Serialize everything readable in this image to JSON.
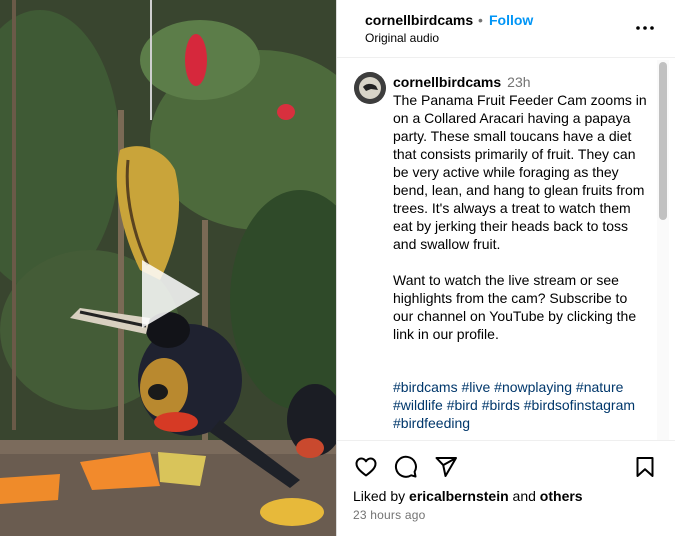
{
  "header": {
    "username": "cornellbirdcams",
    "separator": "•",
    "follow_label": "Follow",
    "audio_label": "Original audio"
  },
  "caption": {
    "username": "cornellbirdcams",
    "time": "23h",
    "text": "The Panama Fruit Feeder Cam zooms in on a Collared Aracari having a papaya party. These small toucans have a diet that consists primarily of fruit. They can be very active while foraging as they bend, lean, and hang to glean fruits from trees. It's always a treat to watch them eat by jerking their heads back to toss and swallow fruit.\n\nWant to watch the live stream or see highlights from the cam? Subscribe to our channel on YouTube by clicking the link in our profile.",
    "hashtags": [
      "#birdcams",
      "#live",
      "#nowplaying",
      "#nature",
      "#wildlife",
      "#bird",
      "#birds",
      "#birdsofinstagram",
      "#birdfeeding"
    ]
  },
  "footer": {
    "liked_prefix": "Liked by",
    "liked_user": "ericalbernstein",
    "liked_and": "and",
    "liked_others": "others",
    "time_ago": "23 hours ago"
  },
  "icons": {
    "more": "more-options-icon",
    "like": "heart-icon",
    "comment": "comment-icon",
    "share": "share-icon",
    "save": "bookmark-icon",
    "play": "play-icon"
  },
  "colors": {
    "link_blue": "#0095f6",
    "hashtag_blue": "#00376b",
    "secondary_text": "#737373"
  }
}
